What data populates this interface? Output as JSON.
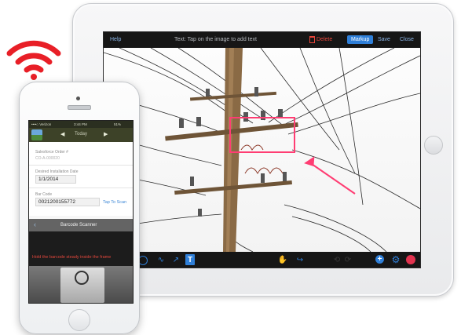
{
  "ipad": {
    "toolbar": {
      "help": "Help",
      "title": "Text: Tap on the image to add text",
      "delete": "Delete",
      "markup": "Markup",
      "save": "Save",
      "close": "Close"
    },
    "bottom_tools": [
      "circle-tool-icon",
      "freehand-tool-icon",
      "arrow-tool-icon",
      "text-tool-icon",
      "multitouch-icon",
      "redo-icon",
      "undo-icon",
      "forward-icon",
      "add-icon",
      "settings-icon",
      "hand-icon"
    ],
    "accent_color": "#2f7fd8",
    "delete_color": "#e6453a",
    "annotation_color": "#ff3d73"
  },
  "iphone": {
    "status": {
      "carrier": "••••○ Verizon",
      "time": "3:44 PM",
      "battery": "51%"
    },
    "nav": {
      "title": "Today",
      "prev": "◀",
      "next": "▶"
    },
    "form": {
      "order_label": "Salesforce Order #",
      "order_value": "CO-A-000020",
      "date_label": "Desired Installation Date",
      "date_value": "1/1/2014",
      "barcode_label": "Bar Code",
      "barcode_value": "0021200155772",
      "scan_link": "Tap To Scan"
    },
    "scanner": {
      "title": "Barcode Scanner",
      "hint": "Hold the barcode steady inside the frame"
    }
  },
  "wifi_color": "#e81f27"
}
